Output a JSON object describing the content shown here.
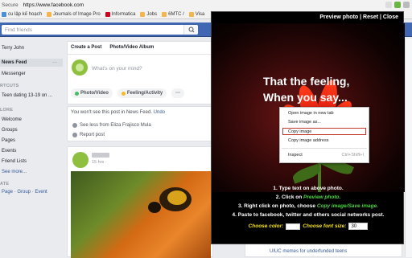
{
  "browser": {
    "secure_label": "Secure",
    "url": "https://www.facebook.com",
    "bookmarks": [
      "cu lập kế hoạch",
      "Journals of Image Pro",
      "Informatica",
      "Jobs",
      "6MTC /",
      "Visa"
    ]
  },
  "header": {
    "search_placeholder": "Find friends"
  },
  "left_nav": {
    "user": "Terry John",
    "news_feed": "News Feed",
    "messenger": "Messenger",
    "shortcuts_header": "RTCUTS",
    "shortcut_item": "Teen dating 13-19 on ...",
    "explore_header": "LORE",
    "explore_items": [
      "Welcome",
      "Groups",
      "Pages",
      "Events",
      "Friend Lists"
    ],
    "see_more": "See more...",
    "create_header": "ATE",
    "create_links": "Page · Group · Event"
  },
  "composer": {
    "tab_post": "Create a Post",
    "tab_album": "Photo/Video Album",
    "placeholder": "What's on your mind?",
    "actions": [
      {
        "label": "Photo/Video",
        "color": "#45bd62"
      },
      {
        "label": "Feeling/Activity",
        "color": "#f7b928"
      },
      {
        "label": "···",
        "color": "#90949c"
      }
    ]
  },
  "hidden_post": {
    "message": "You won't see this post in News Feed.",
    "undo": "Undo",
    "see_less": "See less from Eliza Frajisco Mula",
    "report": "Report post"
  },
  "post": {
    "meta": "15 hrs · "
  },
  "popup": {
    "links": "Preview photo | Reset | Close",
    "overlay_line1": "That the feeling,",
    "overlay_line2": "When you say...",
    "context_menu": {
      "open": "Open image in new tab",
      "save": "Save image as...",
      "copy": "Copy image",
      "copy_address": "Copy image address",
      "inspect": "Inspect",
      "inspect_shortcut": "Ctrl+Shift+I"
    },
    "instructions": {
      "step1": "1. Type text on above photo.",
      "step2_prefix": "2. Click on ",
      "step2_link": "Preview photo.",
      "step3_prefix": "3. Right click on photo, choose ",
      "step3_link": "Copy image/Save image.",
      "step4": "4. Paste to facebook, twitter and others social networks post."
    },
    "choose_color": "Choose color:",
    "choose_font_size": "Choose font size:",
    "font_size_value": "30",
    "accent_yellow": "#f4e11b",
    "accent_green": "#4bd33f"
  },
  "bottom_card": {
    "text": "UIUC memes for underfunded teens"
  }
}
